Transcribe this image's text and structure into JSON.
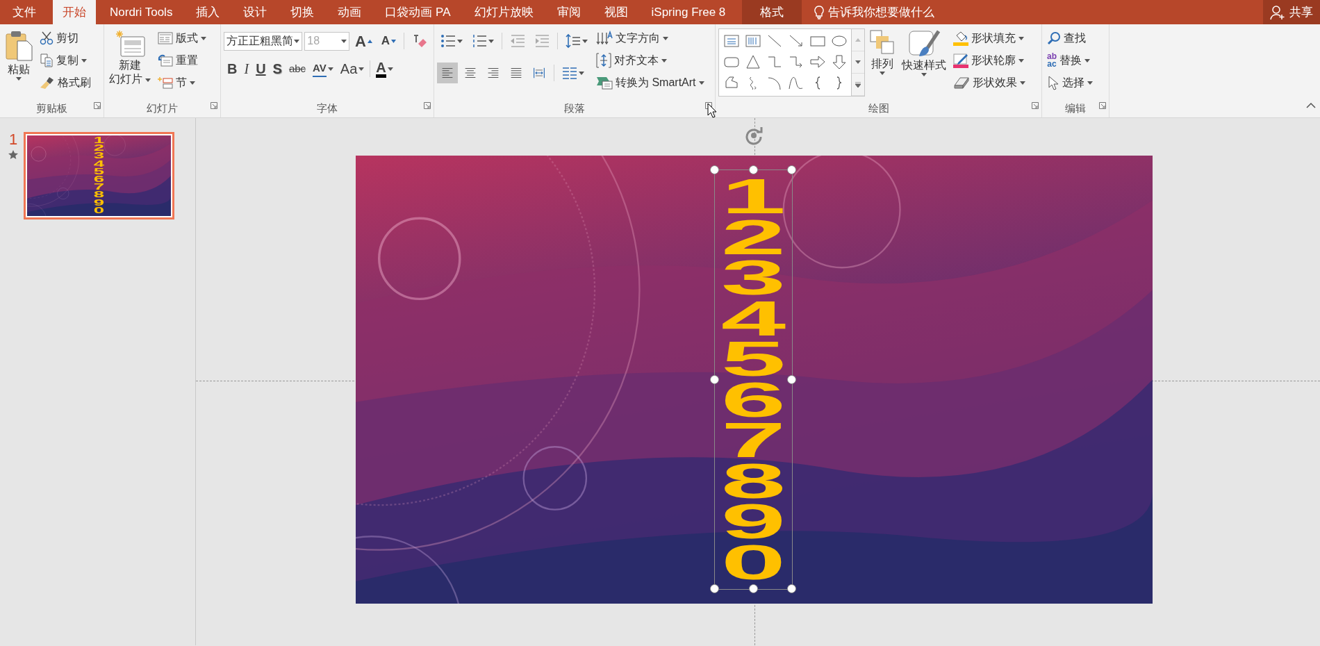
{
  "tabs": [
    {
      "label": "文件",
      "selected": false,
      "kind": "file"
    },
    {
      "label": "开始",
      "selected": true,
      "kind": "tab"
    },
    {
      "label": "Nordri Tools",
      "selected": false,
      "kind": "tab"
    },
    {
      "label": "插入",
      "selected": false,
      "kind": "tab"
    },
    {
      "label": "设计",
      "selected": false,
      "kind": "tab"
    },
    {
      "label": "切换",
      "selected": false,
      "kind": "tab"
    },
    {
      "label": "动画",
      "selected": false,
      "kind": "tab"
    },
    {
      "label": "口袋动画 PA",
      "selected": false,
      "kind": "tab"
    },
    {
      "label": "幻灯片放映",
      "selected": false,
      "kind": "tab"
    },
    {
      "label": "审阅",
      "selected": false,
      "kind": "tab"
    },
    {
      "label": "视图",
      "selected": false,
      "kind": "tab"
    },
    {
      "label": "iSpring Free 8",
      "selected": false,
      "kind": "tab"
    },
    {
      "label": "格式",
      "selected": false,
      "kind": "contextual"
    }
  ],
  "tell_me": {
    "placeholder": "告诉我你想要做什么"
  },
  "share": {
    "label": "共享"
  },
  "clipboard": {
    "label": "剪贴板",
    "paste": "粘贴",
    "cut": "剪切",
    "copy": "复制",
    "format_painter": "格式刷"
  },
  "slides_group": {
    "label": "幻灯片",
    "new_slide": [
      "新建",
      "幻灯片"
    ],
    "layout": "版式",
    "reset": "重置",
    "section": "节"
  },
  "font": {
    "label": "字体",
    "font_name": "方正正粗黑简",
    "font_size": "18",
    "font_size_disabled": true,
    "grow": "A",
    "shrink": "A",
    "styles": [
      "B",
      "I",
      "U",
      "S",
      "abc",
      "AV",
      "Aa"
    ],
    "font_color": {
      "label": "A",
      "color": "#000000"
    }
  },
  "paragraph": {
    "label": "段落",
    "alignment": [
      {
        "kind": "left",
        "selected": true
      },
      {
        "kind": "center",
        "selected": false
      },
      {
        "kind": "right",
        "selected": false
      },
      {
        "kind": "justify",
        "selected": false
      },
      {
        "kind": "distributed",
        "selected": false
      }
    ],
    "text_direction": "文字方向",
    "align_text": "对齐文本",
    "smartart": "转换为 SmartArt"
  },
  "drawing": {
    "label": "绘图",
    "arrange": "排列",
    "quick_styles": "快速样式",
    "shape_fill": {
      "label": "形状填充",
      "color": "#ffc000"
    },
    "shape_outline": {
      "label": "形状轮廓",
      "color": "#e8336f"
    },
    "shape_effects": "形状效果"
  },
  "editing": {
    "label": "编辑",
    "find": "查找",
    "replace": "替换",
    "replace_glyph": [
      "ab",
      "ac"
    ],
    "select": "选择"
  },
  "slide_pane": {
    "slides": [
      {
        "number": "1",
        "selected": true,
        "animated": true,
        "text": "1234567890"
      }
    ]
  },
  "slide": {
    "text_box": {
      "text": "1234567890",
      "selected": true
    }
  }
}
